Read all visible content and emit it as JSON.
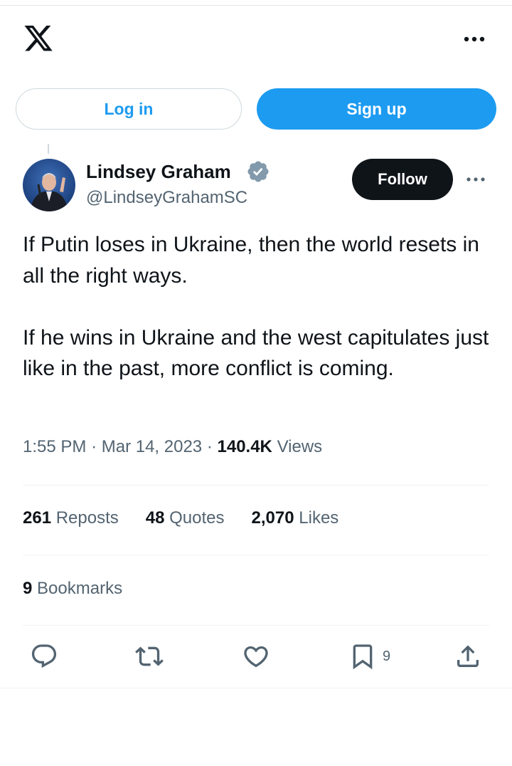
{
  "header": {
    "logo_icon": "x-logo-icon",
    "more_icon": "more-horizontal-icon"
  },
  "auth": {
    "login_label": "Log in",
    "signup_label": "Sign up"
  },
  "tweet": {
    "author_name": "Lindsey Graham",
    "handle": "@LindseyGrahamSC",
    "verified_icon": "verified-badge-icon",
    "follow_label": "Follow",
    "text_paragraph_1": "If Putin loses in Ukraine, then the world resets in all the right ways.",
    "text_paragraph_2": "If he wins in Ukraine and the west capitulates just like in the past, more conflict is coming.",
    "time": "1:55 PM",
    "separator": "·",
    "date": "Mar 14, 2023",
    "views_count": "140.4K",
    "views_label": "Views"
  },
  "stats": {
    "reposts_count": "261",
    "reposts_label": "Reposts",
    "quotes_count": "48",
    "quotes_label": "Quotes",
    "likes_count": "2,070",
    "likes_label": "Likes",
    "bookmarks_count": "9",
    "bookmarks_label": "Bookmarks"
  },
  "actions": {
    "reply_icon": "reply-icon",
    "repost_icon": "repost-icon",
    "like_icon": "heart-icon",
    "bookmark_icon": "bookmark-icon",
    "bookmark_count": "9",
    "share_icon": "share-icon"
  },
  "colors": {
    "accent": "#1d9bf0",
    "text_primary": "#0f1419",
    "text_secondary": "#536471",
    "verified": "#829aab"
  }
}
